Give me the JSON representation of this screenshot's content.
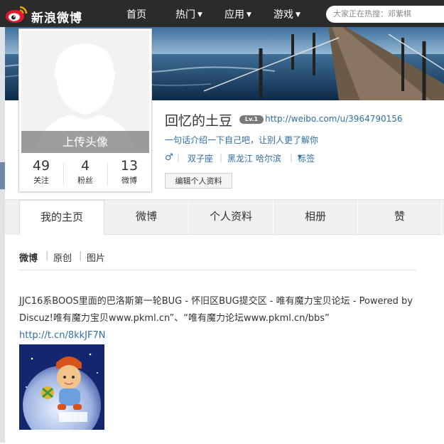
{
  "topbar": {
    "logo_text": "新浪微博",
    "nav": [
      {
        "label": "首页",
        "has_caret": false
      },
      {
        "label": "热门",
        "has_caret": true
      },
      {
        "label": "应用",
        "has_caret": true
      },
      {
        "label": "游戏",
        "has_caret": true
      }
    ],
    "search_placeholder": "大家正在热搜：邓紫棋",
    "caret_glyph": "▼"
  },
  "profile": {
    "upload_label": "上传头像",
    "stats": [
      {
        "num": "49",
        "label": "关注"
      },
      {
        "num": "4",
        "label": "粉丝"
      },
      {
        "num": "13",
        "label": "微博"
      }
    ],
    "username": "回忆的土豆",
    "level": "Lv.1",
    "url": "http://weibo.com/u/3964790156",
    "intro": "一句话介绍一下自己吧，让别人更了解你",
    "gender_symbol": "♂",
    "sign": "双子座",
    "location": "黑龙江 哈尔滨",
    "tags_label": "标签",
    "edit_label": "编辑个人资料",
    "separator": "|"
  },
  "tabs": [
    "我的主页",
    "微博",
    "个人资料",
    "相册",
    "赞"
  ],
  "subtabs": [
    "微博",
    "原创",
    "图片"
  ],
  "post": {
    "text": "JJC16系BOOS里面的巴洛斯第一轮BUG - 怀旧区BUG提交区 - 唯有魔力宝贝论坛 - Powered by Discuz!唯有魔力宝贝www.pkml.cn”、“唯有魔力论坛www.pkml.cn/bbs”",
    "link": "http://t.cn/8kkJF7N"
  },
  "colors": {
    "topbar": "#2b2b2b",
    "link": "#2f6ea6",
    "tab_bg": "#f0f0f0"
  },
  "icons": [
    "weibo-eye-logo-icon",
    "caret-down-icon",
    "male-icon",
    "avatar-placeholder-icon"
  ]
}
